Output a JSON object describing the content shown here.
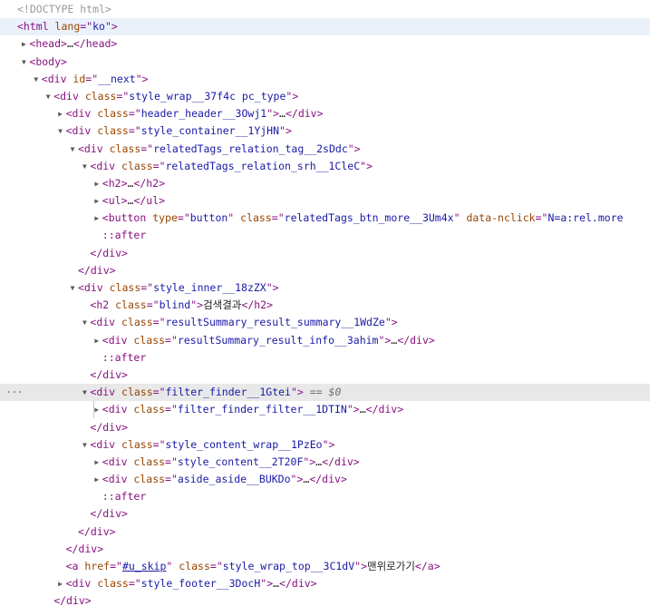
{
  "dom_tree": {
    "lines": [
      {
        "indent": 0,
        "toggle": "",
        "tokens": [
          {
            "k": "dim",
            "t": "<!DOCTYPE html>"
          }
        ]
      },
      {
        "indent": 0,
        "toggle": "",
        "hl": true,
        "tokens": [
          {
            "k": "tag",
            "t": "<html "
          },
          {
            "k": "attr",
            "t": "lang"
          },
          {
            "k": "tag",
            "t": "=\""
          },
          {
            "k": "val",
            "t": "ko"
          },
          {
            "k": "tag",
            "t": "\">"
          }
        ]
      },
      {
        "indent": 1,
        "toggle": "closed",
        "tokens": [
          {
            "k": "tag",
            "t": "<head>"
          },
          {
            "k": "txt",
            "t": "…"
          },
          {
            "k": "tag",
            "t": "</head>"
          }
        ]
      },
      {
        "indent": 1,
        "toggle": "open",
        "tokens": [
          {
            "k": "tag",
            "t": "<body>"
          }
        ]
      },
      {
        "indent": 2,
        "toggle": "open",
        "tokens": [
          {
            "k": "tag",
            "t": "<div "
          },
          {
            "k": "attr",
            "t": "id"
          },
          {
            "k": "tag",
            "t": "=\""
          },
          {
            "k": "val",
            "t": "__next"
          },
          {
            "k": "tag",
            "t": "\">"
          }
        ]
      },
      {
        "indent": 3,
        "toggle": "open",
        "tokens": [
          {
            "k": "tag",
            "t": "<div "
          },
          {
            "k": "attr",
            "t": "class"
          },
          {
            "k": "tag",
            "t": "=\""
          },
          {
            "k": "val",
            "t": "style_wrap__37f4c pc_type"
          },
          {
            "k": "tag",
            "t": "\">"
          }
        ]
      },
      {
        "indent": 4,
        "toggle": "closed",
        "tokens": [
          {
            "k": "tag",
            "t": "<div "
          },
          {
            "k": "attr",
            "t": "class"
          },
          {
            "k": "tag",
            "t": "=\""
          },
          {
            "k": "val",
            "t": "header_header__3Owj1"
          },
          {
            "k": "tag",
            "t": "\">"
          },
          {
            "k": "txt",
            "t": "…"
          },
          {
            "k": "tag",
            "t": "</div>"
          }
        ]
      },
      {
        "indent": 4,
        "toggle": "open",
        "tokens": [
          {
            "k": "tag",
            "t": "<div "
          },
          {
            "k": "attr",
            "t": "class"
          },
          {
            "k": "tag",
            "t": "=\""
          },
          {
            "k": "val",
            "t": "style_container__1YjHN"
          },
          {
            "k": "tag",
            "t": "\">"
          }
        ]
      },
      {
        "indent": 5,
        "toggle": "open",
        "tokens": [
          {
            "k": "tag",
            "t": "<div "
          },
          {
            "k": "attr",
            "t": "class"
          },
          {
            "k": "tag",
            "t": "=\""
          },
          {
            "k": "val",
            "t": "relatedTags_relation_tag__2sDdc"
          },
          {
            "k": "tag",
            "t": "\">"
          }
        ]
      },
      {
        "indent": 6,
        "toggle": "open",
        "tokens": [
          {
            "k": "tag",
            "t": "<div "
          },
          {
            "k": "attr",
            "t": "class"
          },
          {
            "k": "tag",
            "t": "=\""
          },
          {
            "k": "val",
            "t": "relatedTags_relation_srh__1CleC"
          },
          {
            "k": "tag",
            "t": "\">"
          }
        ]
      },
      {
        "indent": 7,
        "toggle": "closed",
        "tokens": [
          {
            "k": "tag",
            "t": "<h2>"
          },
          {
            "k": "txt",
            "t": "…"
          },
          {
            "k": "tag",
            "t": "</h2>"
          }
        ]
      },
      {
        "indent": 7,
        "toggle": "closed",
        "tokens": [
          {
            "k": "tag",
            "t": "<ul>"
          },
          {
            "k": "txt",
            "t": "…"
          },
          {
            "k": "tag",
            "t": "</ul>"
          }
        ]
      },
      {
        "indent": 7,
        "toggle": "closed",
        "tokens": [
          {
            "k": "tag",
            "t": "<button "
          },
          {
            "k": "attr",
            "t": "type"
          },
          {
            "k": "tag",
            "t": "=\""
          },
          {
            "k": "val",
            "t": "button"
          },
          {
            "k": "tag",
            "t": "\" "
          },
          {
            "k": "attr",
            "t": "class"
          },
          {
            "k": "tag",
            "t": "=\""
          },
          {
            "k": "val",
            "t": "relatedTags_btn_more__3Um4x"
          },
          {
            "k": "tag",
            "t": "\" "
          },
          {
            "k": "attr",
            "t": "data-nclick"
          },
          {
            "k": "tag",
            "t": "=\""
          },
          {
            "k": "val",
            "t": "N=a:rel.more"
          }
        ]
      },
      {
        "indent": 7,
        "toggle": "",
        "tokens": [
          {
            "k": "pseudo",
            "t": "::after"
          }
        ]
      },
      {
        "indent": 6,
        "toggle": "",
        "tokens": [
          {
            "k": "tag",
            "t": "</div>"
          }
        ]
      },
      {
        "indent": 5,
        "toggle": "",
        "tokens": [
          {
            "k": "tag",
            "t": "</div>"
          }
        ]
      },
      {
        "indent": 5,
        "toggle": "open",
        "tokens": [
          {
            "k": "tag",
            "t": "<div "
          },
          {
            "k": "attr",
            "t": "class"
          },
          {
            "k": "tag",
            "t": "=\""
          },
          {
            "k": "val",
            "t": "style_inner__18zZX"
          },
          {
            "k": "tag",
            "t": "\">"
          }
        ]
      },
      {
        "indent": 6,
        "toggle": "",
        "tokens": [
          {
            "k": "tag",
            "t": "<h2 "
          },
          {
            "k": "attr",
            "t": "class"
          },
          {
            "k": "tag",
            "t": "=\""
          },
          {
            "k": "val",
            "t": "blind"
          },
          {
            "k": "tag",
            "t": "\">"
          },
          {
            "k": "txt",
            "t": "검색결과"
          },
          {
            "k": "tag",
            "t": "</h2>"
          }
        ]
      },
      {
        "indent": 6,
        "toggle": "open",
        "tokens": [
          {
            "k": "tag",
            "t": "<div "
          },
          {
            "k": "attr",
            "t": "class"
          },
          {
            "k": "tag",
            "t": "=\""
          },
          {
            "k": "val",
            "t": "resultSummary_result_summary__1WdZe"
          },
          {
            "k": "tag",
            "t": "\">"
          }
        ]
      },
      {
        "indent": 7,
        "toggle": "closed",
        "tokens": [
          {
            "k": "tag",
            "t": "<div "
          },
          {
            "k": "attr",
            "t": "class"
          },
          {
            "k": "tag",
            "t": "=\""
          },
          {
            "k": "val",
            "t": "resultSummary_result_info__3ahim"
          },
          {
            "k": "tag",
            "t": "\">"
          },
          {
            "k": "txt",
            "t": "…"
          },
          {
            "k": "tag",
            "t": "</div>"
          }
        ]
      },
      {
        "indent": 7,
        "toggle": "",
        "tokens": [
          {
            "k": "pseudo",
            "t": "::after"
          }
        ]
      },
      {
        "indent": 6,
        "toggle": "",
        "tokens": [
          {
            "k": "tag",
            "t": "</div>"
          }
        ]
      },
      {
        "indent": 6,
        "toggle": "open",
        "sel": true,
        "dots": "...",
        "tokens": [
          {
            "k": "tag",
            "t": "<div "
          },
          {
            "k": "attr",
            "t": "class"
          },
          {
            "k": "tag",
            "t": "=\""
          },
          {
            "k": "val",
            "t": "filter_finder__1Gtei"
          },
          {
            "k": "tag",
            "t": "\">"
          },
          {
            "k": "eq",
            "t": " == $0"
          }
        ]
      },
      {
        "indent": 7,
        "toggle": "closed",
        "gutter": true,
        "tokens": [
          {
            "k": "tag",
            "t": "<div "
          },
          {
            "k": "attr",
            "t": "class"
          },
          {
            "k": "tag",
            "t": "=\""
          },
          {
            "k": "val",
            "t": "filter_finder_filter__1DTIN"
          },
          {
            "k": "tag",
            "t": "\">"
          },
          {
            "k": "txt",
            "t": "…"
          },
          {
            "k": "tag",
            "t": "</div>"
          }
        ]
      },
      {
        "indent": 6,
        "toggle": "",
        "tokens": [
          {
            "k": "tag",
            "t": "</div>"
          }
        ]
      },
      {
        "indent": 6,
        "toggle": "open",
        "tokens": [
          {
            "k": "tag",
            "t": "<div "
          },
          {
            "k": "attr",
            "t": "class"
          },
          {
            "k": "tag",
            "t": "=\""
          },
          {
            "k": "val",
            "t": "style_content_wrap__1PzEo"
          },
          {
            "k": "tag",
            "t": "\">"
          }
        ]
      },
      {
        "indent": 7,
        "toggle": "closed",
        "tokens": [
          {
            "k": "tag",
            "t": "<div "
          },
          {
            "k": "attr",
            "t": "class"
          },
          {
            "k": "tag",
            "t": "=\""
          },
          {
            "k": "val",
            "t": "style_content__2T20F"
          },
          {
            "k": "tag",
            "t": "\">"
          },
          {
            "k": "txt",
            "t": "…"
          },
          {
            "k": "tag",
            "t": "</div>"
          }
        ]
      },
      {
        "indent": 7,
        "toggle": "closed",
        "tokens": [
          {
            "k": "tag",
            "t": "<div "
          },
          {
            "k": "attr",
            "t": "class"
          },
          {
            "k": "tag",
            "t": "=\""
          },
          {
            "k": "val",
            "t": "aside_aside__BUKDo"
          },
          {
            "k": "tag",
            "t": "\">"
          },
          {
            "k": "txt",
            "t": "…"
          },
          {
            "k": "tag",
            "t": "</div>"
          }
        ]
      },
      {
        "indent": 7,
        "toggle": "",
        "tokens": [
          {
            "k": "pseudo",
            "t": "::after"
          }
        ]
      },
      {
        "indent": 6,
        "toggle": "",
        "tokens": [
          {
            "k": "tag",
            "t": "</div>"
          }
        ]
      },
      {
        "indent": 5,
        "toggle": "",
        "tokens": [
          {
            "k": "tag",
            "t": "</div>"
          }
        ]
      },
      {
        "indent": 4,
        "toggle": "",
        "tokens": [
          {
            "k": "tag",
            "t": "</div>"
          }
        ]
      },
      {
        "indent": 4,
        "toggle": "",
        "tokens": [
          {
            "k": "tag",
            "t": "<a "
          },
          {
            "k": "attr",
            "t": "href"
          },
          {
            "k": "tag",
            "t": "=\""
          },
          {
            "k": "link",
            "t": "#u_skip"
          },
          {
            "k": "tag",
            "t": "\" "
          },
          {
            "k": "attr",
            "t": "class"
          },
          {
            "k": "tag",
            "t": "=\""
          },
          {
            "k": "val",
            "t": "style_wrap_top__3C1dV"
          },
          {
            "k": "tag",
            "t": "\">"
          },
          {
            "k": "txt",
            "t": "맨위로가기"
          },
          {
            "k": "tag",
            "t": "</a>"
          }
        ]
      },
      {
        "indent": 4,
        "toggle": "closed",
        "tokens": [
          {
            "k": "tag",
            "t": "<div "
          },
          {
            "k": "attr",
            "t": "class"
          },
          {
            "k": "tag",
            "t": "=\""
          },
          {
            "k": "val",
            "t": "style_footer__3DocH"
          },
          {
            "k": "tag",
            "t": "\">"
          },
          {
            "k": "txt",
            "t": "…"
          },
          {
            "k": "tag",
            "t": "</div>"
          }
        ]
      },
      {
        "indent": 3,
        "toggle": "",
        "tokens": [
          {
            "k": "tag",
            "t": "</div>"
          }
        ]
      }
    ]
  }
}
